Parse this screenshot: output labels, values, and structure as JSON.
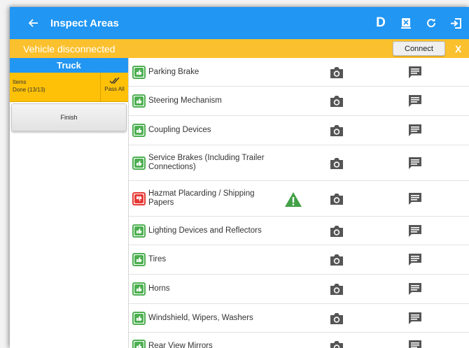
{
  "header": {
    "title": "Inspect Areas",
    "driver_label": "D",
    "icons": [
      "back-arrow-icon",
      "export-icon",
      "refresh-icon",
      "logout-icon"
    ]
  },
  "banner": {
    "text": "Vehicle disconnected",
    "connect_label": "Connect",
    "close_label": "X",
    "color": "#fbc02d"
  },
  "sidebar": {
    "truck_label": "Truck",
    "items_label": "Items",
    "items_status": "Done (13/13)",
    "pass_all_label": "Pass All",
    "finish_label": "Finish"
  },
  "list": {
    "items": [
      {
        "label": "Parking Brake",
        "status": "pass"
      },
      {
        "label": "Steering Mechanism",
        "status": "pass"
      },
      {
        "label": "Coupling Devices",
        "status": "pass"
      },
      {
        "label": "Service Brakes (Including Trailer Connections)",
        "status": "pass"
      },
      {
        "label": "Hazmat Placarding / Shipping Papers",
        "status": "fail",
        "warning": true
      },
      {
        "label": "Lighting Devices and Reflectors",
        "status": "pass"
      },
      {
        "label": "Tires",
        "status": "pass"
      },
      {
        "label": "Horns",
        "status": "pass"
      },
      {
        "label": "Windshield, Wipers, Washers",
        "status": "pass"
      },
      {
        "label": "Rear View Mirrors",
        "status": "pass"
      }
    ]
  },
  "colors": {
    "primary": "#2196f3",
    "accent": "#ffc107",
    "pass": "#4caf50",
    "fail": "#e53935",
    "warning": "#43a047"
  }
}
